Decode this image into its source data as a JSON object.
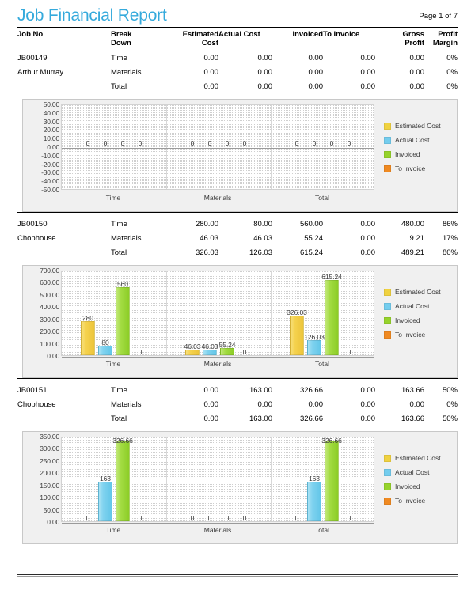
{
  "header": {
    "title": "Job Financial Report",
    "page_indicator": "Page 1 of 7"
  },
  "table": {
    "columns": [
      {
        "key": "job_no",
        "label": "Job No"
      },
      {
        "key": "break_down",
        "label": "Break Down"
      },
      {
        "key": "estimated_cost",
        "label": "Estimated Cost"
      },
      {
        "key": "actual_cost",
        "label": "Actual Cost"
      },
      {
        "key": "invoiced",
        "label": "Invoiced"
      },
      {
        "key": "to_invoice",
        "label": "To Invoice"
      },
      {
        "key": "gross_profit",
        "label": "Gross Profit"
      },
      {
        "key": "profit_margin",
        "label": "Profit Margin"
      }
    ],
    "column_labels_wrapped": {
      "job_no": [
        "Job No",
        ""
      ],
      "break_down": [
        "Break",
        "Down"
      ],
      "estimated_cost": [
        "Estimated",
        "Cost"
      ],
      "actual_cost": [
        "Actual Cost",
        ""
      ],
      "invoiced": [
        "Invoiced",
        ""
      ],
      "to_invoice": [
        "To Invoice",
        ""
      ],
      "gross_profit": [
        "Gross",
        "Profit"
      ],
      "profit_margin": [
        "Profit",
        "Margin"
      ]
    }
  },
  "jobs": [
    {
      "job_no": "JB00149",
      "customer": "Arthur Murray",
      "rows": [
        {
          "break_down": "Time",
          "estimated_cost": "0.00",
          "actual_cost": "0.00",
          "invoiced": "0.00",
          "to_invoice": "0.00",
          "gross_profit": "0.00",
          "profit_margin": "0%"
        },
        {
          "break_down": "Materials",
          "estimated_cost": "0.00",
          "actual_cost": "0.00",
          "invoiced": "0.00",
          "to_invoice": "0.00",
          "gross_profit": "0.00",
          "profit_margin": "0%"
        },
        {
          "break_down": "Total",
          "estimated_cost": "0.00",
          "actual_cost": "0.00",
          "invoiced": "0.00",
          "to_invoice": "0.00",
          "gross_profit": "0.00",
          "profit_margin": "0%"
        }
      ]
    },
    {
      "job_no": "JB00150",
      "customer": "Chophouse",
      "rows": [
        {
          "break_down": "Time",
          "estimated_cost": "280.00",
          "actual_cost": "80.00",
          "invoiced": "560.00",
          "to_invoice": "0.00",
          "gross_profit": "480.00",
          "profit_margin": "86%"
        },
        {
          "break_down": "Materials",
          "estimated_cost": "46.03",
          "actual_cost": "46.03",
          "invoiced": "55.24",
          "to_invoice": "0.00",
          "gross_profit": "9.21",
          "profit_margin": "17%"
        },
        {
          "break_down": "Total",
          "estimated_cost": "326.03",
          "actual_cost": "126.03",
          "invoiced": "615.24",
          "to_invoice": "0.00",
          "gross_profit": "489.21",
          "profit_margin": "80%"
        }
      ]
    },
    {
      "job_no": "JB00151",
      "customer": "Chophouse",
      "rows": [
        {
          "break_down": "Time",
          "estimated_cost": "0.00",
          "actual_cost": "163.00",
          "invoiced": "326.66",
          "to_invoice": "0.00",
          "gross_profit": "163.66",
          "profit_margin": "50%"
        },
        {
          "break_down": "Materials",
          "estimated_cost": "0.00",
          "actual_cost": "0.00",
          "invoiced": "0.00",
          "to_invoice": "0.00",
          "gross_profit": "0.00",
          "profit_margin": "0%"
        },
        {
          "break_down": "Total",
          "estimated_cost": "0.00",
          "actual_cost": "163.00",
          "invoiced": "326.66",
          "to_invoice": "0.00",
          "gross_profit": "163.66",
          "profit_margin": "50%"
        }
      ]
    }
  ],
  "series_colors": {
    "estimated_cost": "#f0d240",
    "actual_cost": "#74cdee",
    "invoiced": "#96d32c",
    "to_invoice": "#f08a22"
  },
  "legend": [
    {
      "label": "Estimated Cost",
      "color": "#f0d240",
      "key": "est"
    },
    {
      "label": "Actual Cost",
      "color": "#74cdee",
      "key": "act"
    },
    {
      "label": "Invoiced",
      "color": "#96d32c",
      "key": "inv"
    },
    {
      "label": "To Invoice",
      "color": "#f08a22",
      "key": "toinv"
    }
  ],
  "chart_data": [
    {
      "id": "chart-jb00149",
      "type": "bar",
      "title": "",
      "xlabel": "",
      "ylabel": "",
      "categories": [
        "Time",
        "Materials",
        "Total"
      ],
      "series": [
        {
          "name": "Estimated Cost",
          "color": "#f0d240",
          "values": [
            0,
            0,
            0
          ],
          "labels": [
            "0",
            "0",
            "0"
          ]
        },
        {
          "name": "Actual Cost",
          "color": "#74cdee",
          "values": [
            0,
            0,
            0
          ],
          "labels": [
            "0",
            "0",
            "0"
          ]
        },
        {
          "name": "Invoiced",
          "color": "#96d32c",
          "values": [
            0,
            0,
            0
          ],
          "labels": [
            "0",
            "0",
            "0"
          ]
        },
        {
          "name": "To Invoice",
          "color": "#f08a22",
          "values": [
            0,
            0,
            0
          ],
          "labels": [
            "0",
            "0",
            "0"
          ]
        }
      ],
      "ylim": [
        -50,
        50
      ],
      "yticks": [
        "50.00",
        "40.00",
        "30.00",
        "20.00",
        "10.00",
        "0.00",
        "-10.00",
        "-20.00",
        "-30.00",
        "-40.00",
        "-50.00"
      ],
      "ytick_values": [
        50,
        40,
        30,
        20,
        10,
        0,
        -10,
        -20,
        -30,
        -40,
        -50
      ],
      "grid": true,
      "legend_position": "right"
    },
    {
      "id": "chart-jb00150",
      "type": "bar",
      "title": "",
      "xlabel": "",
      "ylabel": "",
      "categories": [
        "Time",
        "Materials",
        "Total"
      ],
      "series": [
        {
          "name": "Estimated Cost",
          "color": "#f0d240",
          "values": [
            280,
            46.03,
            326.03
          ],
          "labels": [
            "280",
            "46.03",
            "326.03"
          ]
        },
        {
          "name": "Actual Cost",
          "color": "#74cdee",
          "values": [
            80,
            46.03,
            126.03
          ],
          "labels": [
            "80",
            "46.03",
            "126.03"
          ]
        },
        {
          "name": "Invoiced",
          "color": "#96d32c",
          "values": [
            560,
            55.24,
            615.24
          ],
          "labels": [
            "560",
            "55.24",
            "615.24"
          ]
        },
        {
          "name": "To Invoice",
          "color": "#f08a22",
          "values": [
            0,
            0,
            0
          ],
          "labels": [
            "0",
            "0",
            "0"
          ]
        }
      ],
      "ylim": [
        0,
        700
      ],
      "yticks": [
        "700.00",
        "600.00",
        "500.00",
        "400.00",
        "300.00",
        "200.00",
        "100.00",
        "0.00"
      ],
      "ytick_values": [
        700,
        600,
        500,
        400,
        300,
        200,
        100,
        0
      ],
      "grid": true,
      "legend_position": "right"
    },
    {
      "id": "chart-jb00151",
      "type": "bar",
      "title": "",
      "xlabel": "",
      "ylabel": "",
      "categories": [
        "Time",
        "Materials",
        "Total"
      ],
      "series": [
        {
          "name": "Estimated Cost",
          "color": "#f0d240",
          "values": [
            0,
            0,
            0
          ],
          "labels": [
            "0",
            "0",
            "0"
          ]
        },
        {
          "name": "Actual Cost",
          "color": "#74cdee",
          "values": [
            163,
            0,
            163
          ],
          "labels": [
            "163",
            "0",
            "163"
          ]
        },
        {
          "name": "Invoiced",
          "color": "#96d32c",
          "values": [
            326.66,
            0,
            326.66
          ],
          "labels": [
            "326.66",
            "0",
            "326.66"
          ]
        },
        {
          "name": "To Invoice",
          "color": "#f08a22",
          "values": [
            0,
            0,
            0
          ],
          "labels": [
            "0",
            "0",
            "0"
          ]
        }
      ],
      "ylim": [
        0,
        350
      ],
      "yticks": [
        "350.00",
        "300.00",
        "250.00",
        "200.00",
        "150.00",
        "100.00",
        "50.00",
        "0.00"
      ],
      "ytick_values": [
        350,
        300,
        250,
        200,
        150,
        100,
        50,
        0
      ],
      "grid": true,
      "legend_position": "right"
    }
  ]
}
